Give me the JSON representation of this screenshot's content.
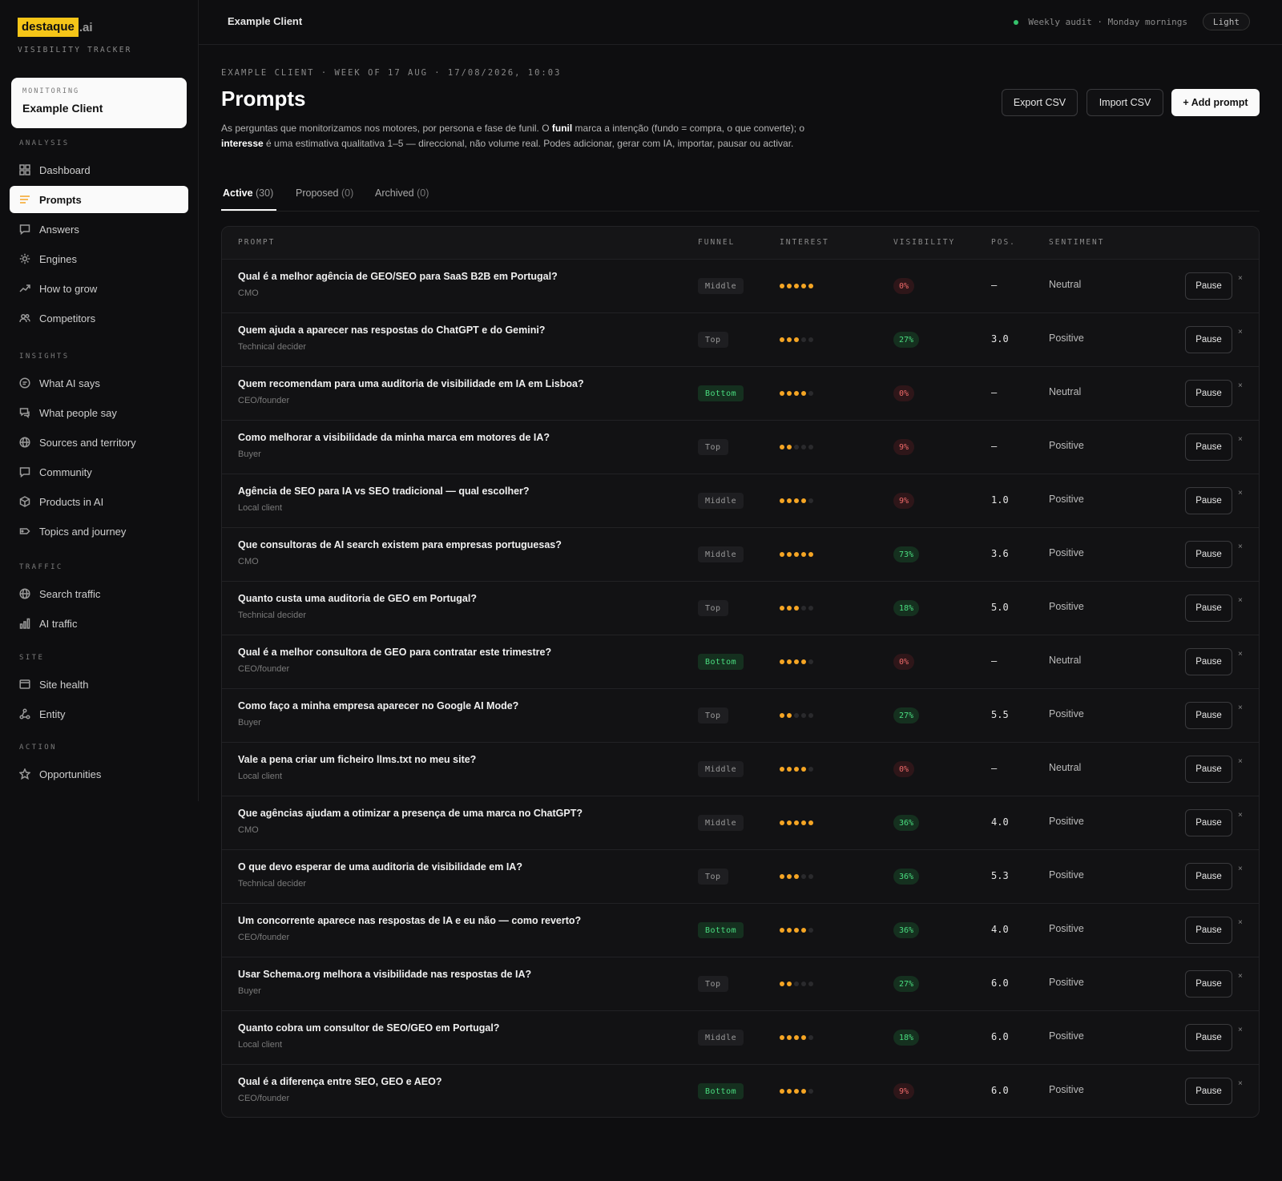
{
  "brand": {
    "name": "destaque",
    "suffix": ".ai",
    "subtitle": "VISIBILITY TRACKER"
  },
  "monitoring": {
    "label": "MONITORING",
    "client": "Example Client"
  },
  "nav": {
    "analysis_label": "ANALYSIS",
    "analysis": [
      "Dashboard",
      "Prompts",
      "Answers",
      "Engines",
      "How to grow",
      "Competitors"
    ],
    "insights_label": "INSIGHTS",
    "insights": [
      "What AI says",
      "What people say",
      "Sources and territory",
      "Community",
      "Products in AI",
      "Topics and journey"
    ],
    "traffic_label": "TRAFFIC",
    "traffic": [
      "Search traffic",
      "AI traffic"
    ],
    "site_label": "SITE",
    "site": [
      "Site health",
      "Entity"
    ],
    "action_label": "ACTION",
    "action": [
      "Opportunities"
    ]
  },
  "topbar": {
    "title": "Example Client",
    "audit": "Weekly audit · Monday mornings",
    "theme": "Light"
  },
  "header": {
    "eyebrow": "EXAMPLE CLIENT · WEEK OF 17 AUG · 17/08/2026, 10:03",
    "title": "Prompts",
    "desc_1": "As perguntas que monitorizamos nos motores, por persona e fase de funil. O ",
    "desc_b1": "funil",
    "desc_2": " marca a intenção (fundo = compra, o que converte); o ",
    "desc_b2": "interesse",
    "desc_3": " é uma estimativa qualitativa 1–5 — direccional, não volume real. Podes adicionar, gerar com IA, importar, pausar ou activar.",
    "export": "Export CSV",
    "import": "Import CSV",
    "add": "+ Add prompt"
  },
  "tabs": [
    {
      "label": "Active",
      "count": "(30)"
    },
    {
      "label": "Proposed",
      "count": "(0)"
    },
    {
      "label": "Archived",
      "count": "(0)"
    }
  ],
  "columns": {
    "prompt": "PROMPT",
    "funnel": "FUNNEL",
    "interest": "INTEREST",
    "visibility": "VISIBILITY",
    "pos": "POS.",
    "sentiment": "SENTIMENT"
  },
  "pause_label": "Pause",
  "close_glyph": "×",
  "rows": [
    {
      "prompt": "Qual é a melhor agência de GEO/SEO para SaaS B2B em Portugal?",
      "persona": "CMO",
      "funnel": "Middle",
      "interest": 5,
      "visibility": "0%",
      "pos": "—",
      "sentiment": "Neutral"
    },
    {
      "prompt": "Quem ajuda a aparecer nas respostas do ChatGPT e do Gemini?",
      "persona": "Technical decider",
      "funnel": "Top",
      "interest": 3,
      "visibility": "27%",
      "pos": "3.0",
      "sentiment": "Positive"
    },
    {
      "prompt": "Quem recomendam para uma auditoria de visibilidade em IA em Lisboa?",
      "persona": "CEO/founder",
      "funnel": "Bottom",
      "interest": 4,
      "visibility": "0%",
      "pos": "—",
      "sentiment": "Neutral"
    },
    {
      "prompt": "Como melhorar a visibilidade da minha marca em motores de IA?",
      "persona": "Buyer",
      "funnel": "Top",
      "interest": 2,
      "visibility": "9%",
      "pos": "—",
      "sentiment": "Positive"
    },
    {
      "prompt": "Agência de SEO para IA vs SEO tradicional — qual escolher?",
      "persona": "Local client",
      "funnel": "Middle",
      "interest": 4,
      "visibility": "9%",
      "pos": "1.0",
      "sentiment": "Positive"
    },
    {
      "prompt": "Que consultoras de AI search existem para empresas portuguesas?",
      "persona": "CMO",
      "funnel": "Middle",
      "interest": 5,
      "visibility": "73%",
      "pos": "3.6",
      "sentiment": "Positive"
    },
    {
      "prompt": "Quanto custa uma auditoria de GEO em Portugal?",
      "persona": "Technical decider",
      "funnel": "Top",
      "interest": 3,
      "visibility": "18%",
      "pos": "5.0",
      "sentiment": "Positive"
    },
    {
      "prompt": "Qual é a melhor consultora de GEO para contratar este trimestre?",
      "persona": "CEO/founder",
      "funnel": "Bottom",
      "interest": 4,
      "visibility": "0%",
      "pos": "—",
      "sentiment": "Neutral"
    },
    {
      "prompt": "Como faço a minha empresa aparecer no Google AI Mode?",
      "persona": "Buyer",
      "funnel": "Top",
      "interest": 2,
      "visibility": "27%",
      "pos": "5.5",
      "sentiment": "Positive"
    },
    {
      "prompt": "Vale a pena criar um ficheiro llms.txt no meu site?",
      "persona": "Local client",
      "funnel": "Middle",
      "interest": 4,
      "visibility": "0%",
      "pos": "—",
      "sentiment": "Neutral"
    },
    {
      "prompt": "Que agências ajudam a otimizar a presença de uma marca no ChatGPT?",
      "persona": "CMO",
      "funnel": "Middle",
      "interest": 5,
      "visibility": "36%",
      "pos": "4.0",
      "sentiment": "Positive"
    },
    {
      "prompt": "O que devo esperar de uma auditoria de visibilidade em IA?",
      "persona": "Technical decider",
      "funnel": "Top",
      "interest": 3,
      "visibility": "36%",
      "pos": "5.3",
      "sentiment": "Positive"
    },
    {
      "prompt": "Um concorrente aparece nas respostas de IA e eu não — como reverto?",
      "persona": "CEO/founder",
      "funnel": "Bottom",
      "interest": 4,
      "visibility": "36%",
      "pos": "4.0",
      "sentiment": "Positive"
    },
    {
      "prompt": "Usar Schema.org melhora a visibilidade nas respostas de IA?",
      "persona": "Buyer",
      "funnel": "Top",
      "interest": 2,
      "visibility": "27%",
      "pos": "6.0",
      "sentiment": "Positive"
    },
    {
      "prompt": "Quanto cobra um consultor de SEO/GEO em Portugal?",
      "persona": "Local client",
      "funnel": "Middle",
      "interest": 4,
      "visibility": "18%",
      "pos": "6.0",
      "sentiment": "Positive"
    },
    {
      "prompt": "Qual é a diferença entre SEO, GEO e AEO?",
      "persona": "CEO/founder",
      "funnel": "Bottom",
      "interest": 4,
      "visibility": "9%",
      "pos": "6.0",
      "sentiment": "Positive"
    }
  ],
  "colors": {
    "accent": "#f5c518",
    "star": "#f5a524",
    "positive": "#4ade80",
    "negative": "#f06a6a",
    "status": "#35c26b"
  }
}
